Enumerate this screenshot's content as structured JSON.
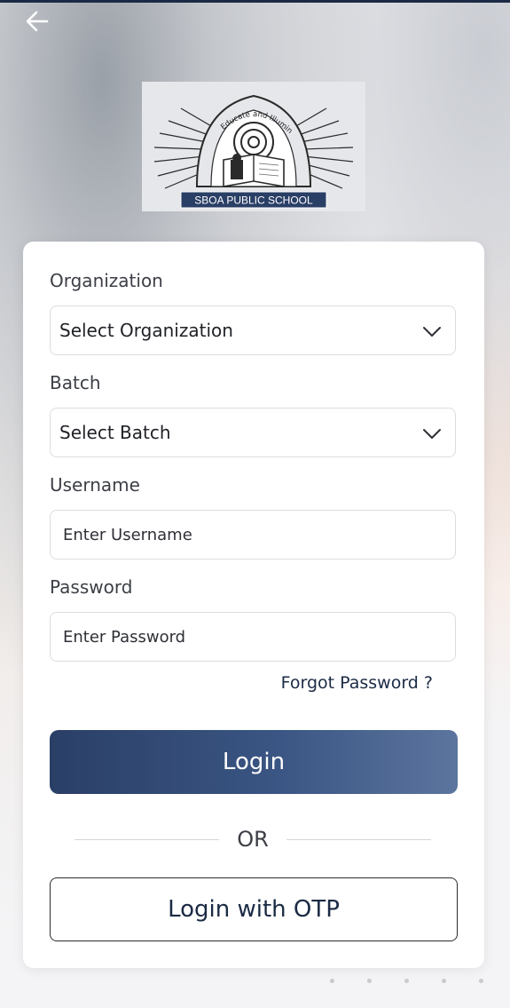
{
  "logo": {
    "motto": "Educate and Illuminate",
    "school_name": "SBOA PUBLIC SCHOOL"
  },
  "form": {
    "organization": {
      "label": "Organization",
      "value": "Select Organization"
    },
    "batch": {
      "label": "Batch",
      "value": "Select Batch"
    },
    "username": {
      "label": "Username",
      "placeholder": "Enter Username"
    },
    "password": {
      "label": "Password",
      "placeholder": "Enter Password"
    },
    "forgot_password": "Forgot Password ?",
    "login_label": "Login",
    "or_label": "OR",
    "otp_label": "Login with OTP"
  },
  "icons": {
    "back": "arrow-left-icon",
    "dropdown": "chevron-down-icon"
  },
  "colors": {
    "primary": "#2a3f66",
    "primary_light": "#5c759f",
    "text": "#1f2126",
    "label": "#3c3f46"
  }
}
